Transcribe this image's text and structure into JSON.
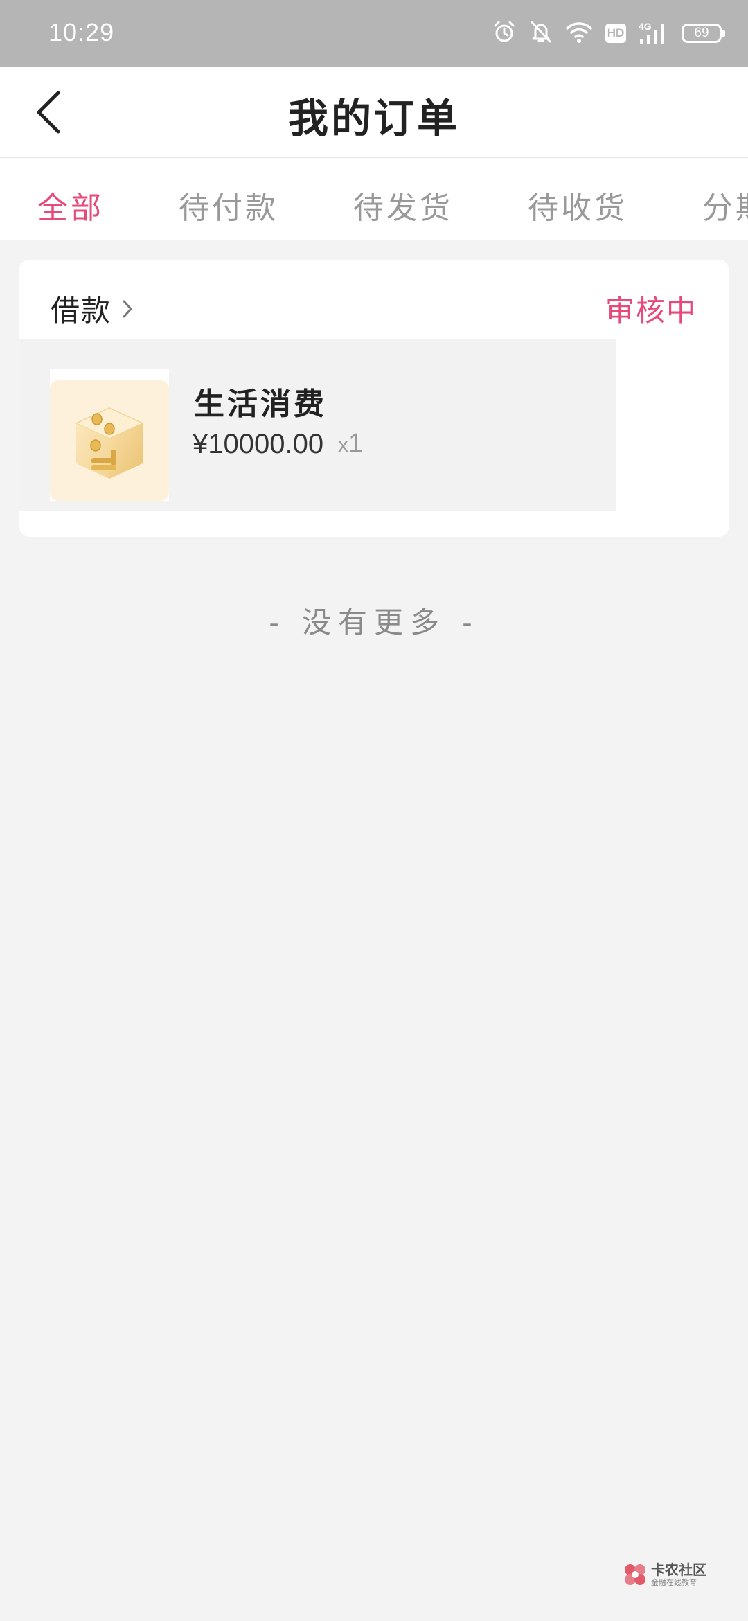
{
  "status_bar": {
    "time": "10:29",
    "icons": [
      "alarm-icon",
      "mute-icon",
      "wifi-icon",
      "hd-icon",
      "signal-4g-icon",
      "battery-icon"
    ],
    "hd_label": "HD",
    "network_label": "4G",
    "battery": "69"
  },
  "header": {
    "title": "我的订单",
    "back_icon": "chevron-left-icon"
  },
  "tabs": [
    {
      "label": "全部",
      "active": true
    },
    {
      "label": "待付款",
      "active": false
    },
    {
      "label": "待发货",
      "active": false
    },
    {
      "label": "待收货",
      "active": false
    },
    {
      "label": "分期",
      "active": false
    }
  ],
  "orders": [
    {
      "type": "借款",
      "status": "审核中",
      "item": {
        "name": "生活消费",
        "price": "¥10000.00",
        "qty_prefix": "x",
        "qty": "1",
        "thumb_icon": "gold-coin-cube-icon"
      }
    }
  ],
  "list_end_text": "- 没有更多 -",
  "watermark": {
    "title": "卡农社区",
    "subtitle": "金融在线教育"
  },
  "colors": {
    "accent": "#e6497a",
    "status_bar": "#b5b5b5",
    "background": "#f3f3f3"
  }
}
